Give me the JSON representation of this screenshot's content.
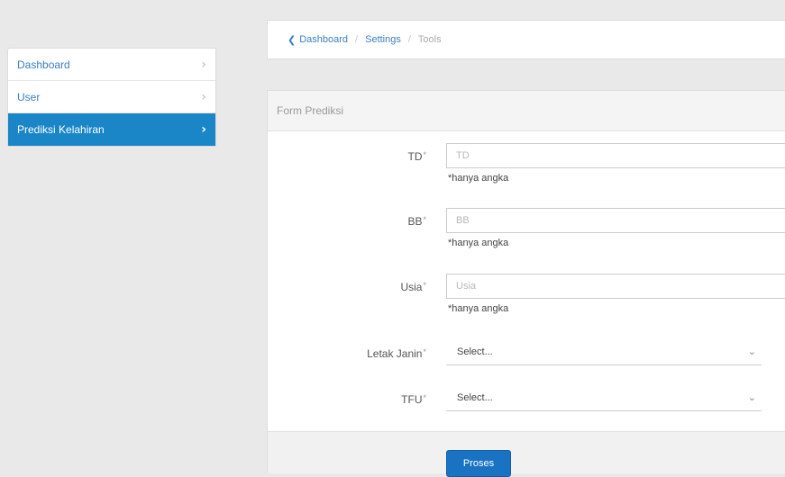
{
  "sidebar": {
    "items": [
      {
        "label": "Dashboard"
      },
      {
        "label": "User"
      },
      {
        "label": "Prediksi Kelahiran"
      }
    ]
  },
  "breadcrumb": {
    "items": [
      "Dashboard",
      "Settings",
      "Tools"
    ]
  },
  "form": {
    "title": "Form Prediksi",
    "fields": [
      {
        "label": "TD",
        "placeholder": "TD",
        "hint": "*hanya angka"
      },
      {
        "label": "BB",
        "placeholder": "BB",
        "hint": "*hanya angka"
      },
      {
        "label": "Usia",
        "placeholder": "Usia",
        "hint": "*hanya angka"
      }
    ],
    "selects": [
      {
        "label": "Letak Janin",
        "value": "Select..."
      },
      {
        "label": "TFU",
        "value": "Select..."
      }
    ],
    "submit_label": "Proses"
  },
  "icons": {
    "sidebar_chevron": "chevron-right-icon",
    "breadcrumb_back": "chevron-left-icon",
    "select_caret": "chevron-down-icon"
  },
  "colors": {
    "accent": "#1a86c8",
    "button": "#1a73c2",
    "link": "#3a7fc1"
  }
}
